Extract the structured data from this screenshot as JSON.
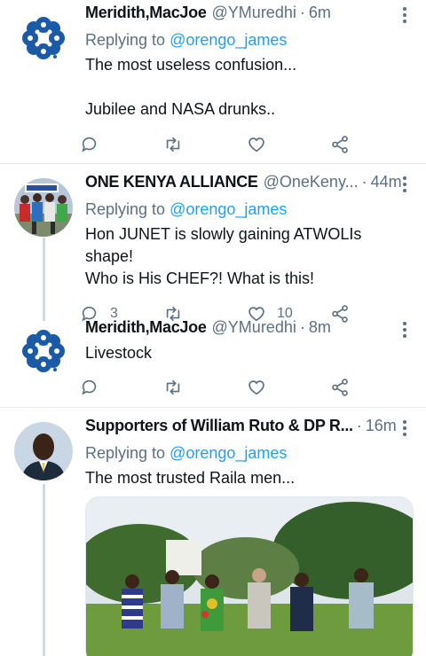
{
  "tweets": [
    {
      "name": "Meridith,MacJoe",
      "handle": "@YMuredhi",
      "dot": "·",
      "time": "6m",
      "reply_prefix": "Replying to ",
      "reply_to": "@orengo_james",
      "text_line1": "The most useless confusion...",
      "text_line2": "Jubilee and NASA drunks..",
      "reply_count": "",
      "like_count": ""
    },
    {
      "name": "ONE KENYA ALLIANCE",
      "handle": "@OneKeny...",
      "dot": "·",
      "time": "44m",
      "reply_prefix": "Replying to ",
      "reply_to": "@orengo_james",
      "text_line1": "Hon JUNET is slowly gaining ATWOLIs shape!",
      "text_line2": "Who is His CHEF?! What is this!",
      "reply_count": "3",
      "like_count": "10"
    },
    {
      "name": "Meridith,MacJoe",
      "handle": "@YMuredhi",
      "dot": "·",
      "time": "8m",
      "text_line1": "Livestock"
    },
    {
      "name": "Supporters of William Ruto & DP R...",
      "dot": "·",
      "time": "16m",
      "reply_prefix": "Replying to ",
      "reply_to": "@orengo_james",
      "text_line1": "The most trusted Raila men..."
    }
  ],
  "icons": {
    "reply": "reply-icon",
    "retweet": "retweet-icon",
    "like": "like-icon",
    "share": "share-icon",
    "more": "more-icon"
  },
  "colors": {
    "accent": "#1da1f2",
    "muted": "#5b7083",
    "logo": "#1a5aa6",
    "divider": "#e6ecf0"
  }
}
